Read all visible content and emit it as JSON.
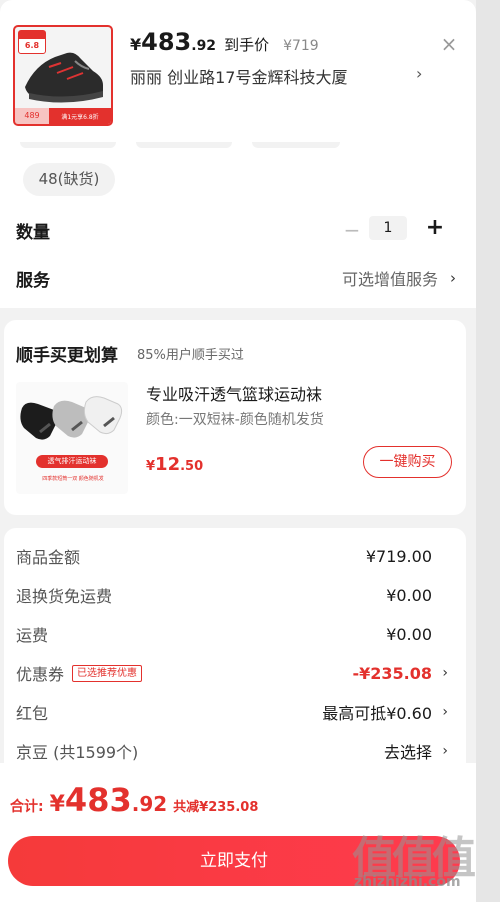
{
  "header": {
    "currency": "¥",
    "price_int": "483",
    "price_dec": ".92",
    "price_suffix": "到手价",
    "original_price": "¥719",
    "address": "丽丽  创业路17号金辉科技大厦",
    "thumb_tag": "6.8",
    "thumb_promo_left": "489",
    "thumb_promo_right": "满1元享6.8折"
  },
  "spec": {
    "size_chip": "48(缺货)",
    "qty_label": "数量",
    "qty_value": "1",
    "service_label": "服务",
    "service_value": "可选增值服务"
  },
  "addon": {
    "title": "顺手买更划算",
    "subtitle": "85%用户顺手买过",
    "name": "专业吸汗透气篮球运动袜",
    "attr": "颜色:一双短袜-颜色随机发货",
    "price_currency": "¥",
    "price_int": "12",
    "price_dec": ".50",
    "buy_label": "一键购买",
    "img_label": "透气排汗运动袜",
    "img_caption": "四季款短筒一双  颜色随机发"
  },
  "detail": {
    "rows": [
      {
        "key": "商品金额",
        "value": "¥719.00"
      },
      {
        "key": "退换货免运费",
        "value": "¥0.00"
      },
      {
        "key": "运费",
        "value": "¥0.00"
      },
      {
        "key": "优惠券",
        "tag": "已选推荐优惠",
        "value": "-¥235.08"
      },
      {
        "key": "红包",
        "value": "最高可抵¥0.60"
      },
      {
        "key": "京豆 (共1599个)",
        "value": "去选择"
      }
    ]
  },
  "footer": {
    "total_label": "合计:",
    "currency": "¥",
    "total_int": "483",
    "total_dec": ".92",
    "saving": "共减¥235.08",
    "pay_label": "立即支付"
  },
  "watermark": {
    "glyphs": "值值值",
    "url": "zhizhizhi.com"
  },
  "colors": {
    "accent": "#e3312d",
    "background": "#f2f2f2"
  }
}
